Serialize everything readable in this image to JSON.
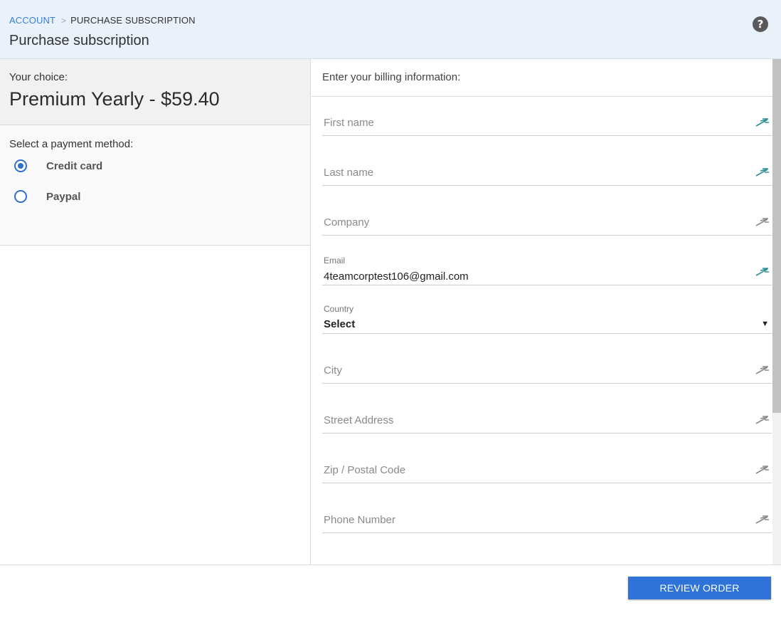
{
  "header": {
    "breadcrumb": {
      "link": "ACCOUNT",
      "separator": ">",
      "current": "PURCHASE SUBSCRIPTION"
    },
    "title": "Purchase subscription",
    "help_icon": "question-circle-icon",
    "help_glyph": "?"
  },
  "choice": {
    "label": "Your choice:",
    "value": "Premium Yearly - $59.40"
  },
  "payment": {
    "label": "Select a payment method:",
    "options": [
      {
        "label": "Credit card",
        "selected": true
      },
      {
        "label": "Paypal",
        "selected": false
      }
    ]
  },
  "billing": {
    "label": "Enter your billing information:",
    "fields": {
      "first_name": {
        "placeholder": "First name",
        "icon": "autofill-icon",
        "icon_color": "#2a8f95"
      },
      "last_name": {
        "placeholder": "Last name",
        "icon": "autofill-icon",
        "icon_color": "#2a8f95"
      },
      "company": {
        "placeholder": "Company",
        "icon": "autofill-icon",
        "icon_color": "#8a8a8a"
      },
      "email": {
        "label": "Email",
        "value": "4teamcorptest106@gmail.com",
        "icon": "autofill-icon",
        "icon_color": "#2a8f95"
      },
      "country": {
        "label": "Country",
        "value": "Select",
        "caret": "▼"
      },
      "city": {
        "placeholder": "City",
        "icon": "autofill-icon",
        "icon_color": "#8a8a8a"
      },
      "street": {
        "placeholder": "Street Address",
        "icon": "autofill-icon",
        "icon_color": "#8a8a8a"
      },
      "zip": {
        "placeholder": "Zip / Postal Code",
        "icon": "autofill-icon",
        "icon_color": "#8a8a8a"
      },
      "phone": {
        "placeholder": "Phone Number",
        "icon": "autofill-icon",
        "icon_color": "#8a8a8a"
      }
    }
  },
  "footer": {
    "review_label": "REVIEW ORDER"
  },
  "colors": {
    "accent": "#2f73d8",
    "header_bg": "#e9f1fb",
    "link": "#3d7ed6"
  }
}
